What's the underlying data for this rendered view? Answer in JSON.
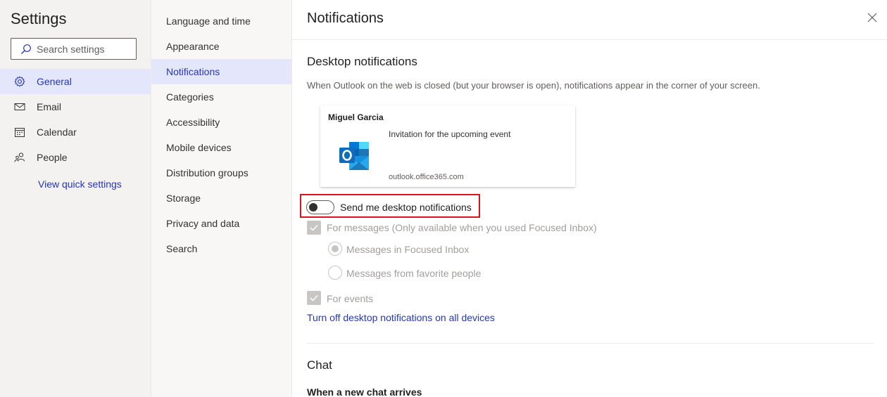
{
  "settings": {
    "title": "Settings",
    "search_placeholder": "Search settings"
  },
  "categories": [
    {
      "label": "General",
      "icon": "gear-icon",
      "active": true
    },
    {
      "label": "Email",
      "icon": "mail-icon",
      "active": false
    },
    {
      "label": "Calendar",
      "icon": "calendar-icon",
      "active": false
    },
    {
      "label": "People",
      "icon": "people-icon",
      "active": false
    }
  ],
  "quick_settings_link": "View quick settings",
  "subcategories": [
    {
      "label": "Language and time",
      "active": false
    },
    {
      "label": "Appearance",
      "active": false
    },
    {
      "label": "Notifications",
      "active": true
    },
    {
      "label": "Categories",
      "active": false
    },
    {
      "label": "Accessibility",
      "active": false
    },
    {
      "label": "Mobile devices",
      "active": false
    },
    {
      "label": "Distribution groups",
      "active": false
    },
    {
      "label": "Storage",
      "active": false
    },
    {
      "label": "Privacy and data",
      "active": false
    },
    {
      "label": "Search",
      "active": false
    }
  ],
  "panel": {
    "title": "Notifications",
    "desktop_section": {
      "title": "Desktop notifications",
      "description": "When Outlook on the web is closed (but your browser is open), notifications appear in the corner of your screen.",
      "preview": {
        "sender": "Miguel Garcia",
        "message": "Invitation for the upcoming event",
        "domain": "outlook.office365.com"
      },
      "toggle": {
        "label": "Send me desktop notifications",
        "on": false
      },
      "messages_checkbox": {
        "label": "For messages (Only available when you used Focused Inbox)",
        "checked": true,
        "disabled": true
      },
      "radio_focused": {
        "label": "Messages in Focused Inbox",
        "selected": true
      },
      "radio_favorites": {
        "label": "Messages from favorite people",
        "selected": false
      },
      "events_checkbox": {
        "label": "For events",
        "checked": true,
        "disabled": true
      },
      "turn_off_link": "Turn off desktop notifications on all devices"
    },
    "chat_section": {
      "title": "Chat",
      "subheading": "When a new chat arrives"
    }
  },
  "colors": {
    "accent": "#2437ba",
    "highlight_border": "#d9131b",
    "active_bg": "#e4e6fb",
    "outlook_blue": "#0f6cbd"
  }
}
